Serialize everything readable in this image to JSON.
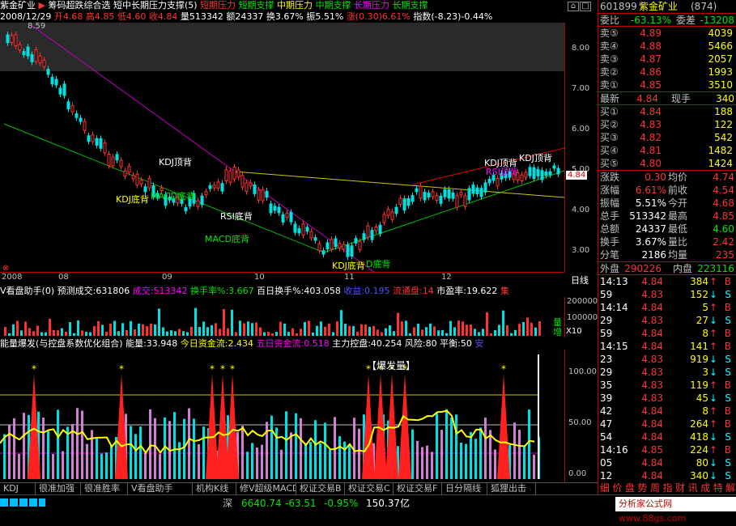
{
  "topbar": {
    "stock_name": "紫金矿业",
    "f1": "筹码超跌综合选",
    "f2": "短中长期压力支撑(5)",
    "p1": "短期压力",
    "p2": "短期支撑",
    "p3": "中期压力",
    "p4": "中期支撑",
    "p5": "长期压力",
    "p6": "长期支撑"
  },
  "ohlc": {
    "date": "2008/12/29",
    "open": "开4.68",
    "high": "高4.85",
    "low": "低4.60",
    "close": "收4.84",
    "vol": "量513342",
    "amt": "额24337",
    "turn": "换3.67%",
    "amp": "振5.51%",
    "chg": "涨(0.30)6.61%",
    "idx": "指数(-8.23)-0.44%"
  },
  "main": {
    "top_label": "8.59",
    "price_ticks": [
      "8.00",
      "7.00",
      "6.00",
      "5.00",
      "4.00",
      "3.00"
    ],
    "cur_price": "4.84",
    "x_dates": [
      "2008",
      "08",
      "09",
      "10",
      "11",
      "12"
    ],
    "annotations": [
      "KDJ顶背",
      "KDJ底背",
      "MACD底背",
      "RSI底背",
      "MACD底背",
      "KDJ底背",
      "D底背",
      "KDJ顶背",
      "KDJ顶背",
      "RSI顶背"
    ]
  },
  "vol": {
    "title": "V看盘助手(0)",
    "pred": "预测成交:631806",
    "cj_label": "成交:513342",
    "hsl": "换手率%:3.667",
    "hundred": "百日换手%:403.058",
    "gain": "收益:0.195",
    "liutong": "流通盘:14",
    "pe": "市盈率:19.622",
    "ji": "集",
    "axis": [
      "200000",
      "100000"
    ],
    "liang": "量",
    "zeng": "增",
    "x10": "X10"
  },
  "ind": {
    "title": "能量爆发(与控盘系数优化组合)",
    "e": "能量:33.948",
    "a": "今日资金流:2.434",
    "b": "五日资金流:0.518",
    "c": "主力控盘:40.254",
    "d": "风险:80",
    "f": "平衡:50",
    "g": "安",
    "burst": "【爆发量】",
    "axis": [
      "100.00",
      "50.00",
      "0.00"
    ]
  },
  "tabs": [
    "KDJ",
    "很准加强",
    "很准胜率",
    "V看盘助手",
    "机构K线",
    "修V超级MACD",
    "权证交易B",
    "权证交易C",
    "权证交易F",
    "日分隔线",
    "狐狸出击"
  ],
  "status": {
    "market": "深",
    "index": "6640.74",
    "chg": "-63.51",
    "pct": "-0.95%",
    "amt": "150.37亿",
    "ad": "分析家公式网",
    "url": "www.88gs.com"
  },
  "side": {
    "code": "601899",
    "name": "紫金矿业",
    "num": "(874)",
    "weibi_l": "委比",
    "weibi": "-63.13%",
    "weicha_l": "委差",
    "weicha": "-13208",
    "asks": [
      {
        "l": "卖⑤",
        "p": "4.89",
        "v": "4039"
      },
      {
        "l": "卖④",
        "p": "4.88",
        "v": "5466"
      },
      {
        "l": "卖③",
        "p": "4.87",
        "v": "2057"
      },
      {
        "l": "卖②",
        "p": "4.86",
        "v": "1993"
      },
      {
        "l": "卖①",
        "p": "4.85",
        "v": "3510"
      }
    ],
    "last_l": "最新",
    "last": "4.84",
    "xs_l": "现手",
    "xs": "340",
    "bids": [
      {
        "l": "买①",
        "p": "4.84",
        "v": "188"
      },
      {
        "l": "买②",
        "p": "4.83",
        "v": "122"
      },
      {
        "l": "买③",
        "p": "4.82",
        "v": "542"
      },
      {
        "l": "买④",
        "p": "4.81",
        "v": "1482"
      },
      {
        "l": "买⑤",
        "p": "4.80",
        "v": "1424"
      }
    ],
    "stats": [
      [
        "涨跌",
        "0.30",
        "均价",
        "4.74"
      ],
      [
        "涨幅",
        "6.61%",
        "前收",
        "4.54"
      ],
      [
        "振幅",
        "5.51%",
        "今开",
        "4.68"
      ],
      [
        "总手",
        "513342",
        "最高",
        "4.85"
      ],
      [
        "总额",
        "24337",
        "最低",
        "4.60"
      ],
      [
        "换手",
        "3.67%",
        "量比",
        "2.42"
      ],
      [
        "分笔",
        "2186",
        "均量",
        "235"
      ]
    ],
    "wai_l": "外盘",
    "wai": "290226",
    "nei_l": "内盘",
    "nei": "223116",
    "ticks": [
      [
        "14:13",
        "4.84",
        "384",
        "B"
      ],
      [
        "59",
        "4.83",
        "152",
        "S"
      ],
      [
        "14:14",
        "4.84",
        "5",
        "B"
      ],
      [
        "29",
        "4.83",
        "27",
        "S"
      ],
      [
        "59",
        "4.84",
        "8",
        "B"
      ],
      [
        "14:15",
        "4.84",
        "141",
        "B"
      ],
      [
        "23",
        "4.83",
        "919",
        "S"
      ],
      [
        "29",
        "4.83",
        "3",
        "S"
      ],
      [
        "35",
        "4.83",
        "119",
        "B"
      ],
      [
        "39",
        "4.83",
        "45",
        "S"
      ],
      [
        "42",
        "4.84",
        "8",
        "B"
      ],
      [
        "47",
        "4.84",
        "264",
        "B"
      ],
      [
        "54",
        "4.84",
        "418",
        "S"
      ],
      [
        "14:16",
        "4.85",
        "224",
        "B"
      ],
      [
        "05",
        "4.84",
        "80",
        "S"
      ],
      [
        "12",
        "4.84",
        "340",
        "S"
      ]
    ],
    "bottom_tabs": [
      "细",
      "价",
      "盘",
      "势",
      "周",
      "指",
      "财",
      "讯",
      "成",
      "特",
      "解"
    ]
  }
}
